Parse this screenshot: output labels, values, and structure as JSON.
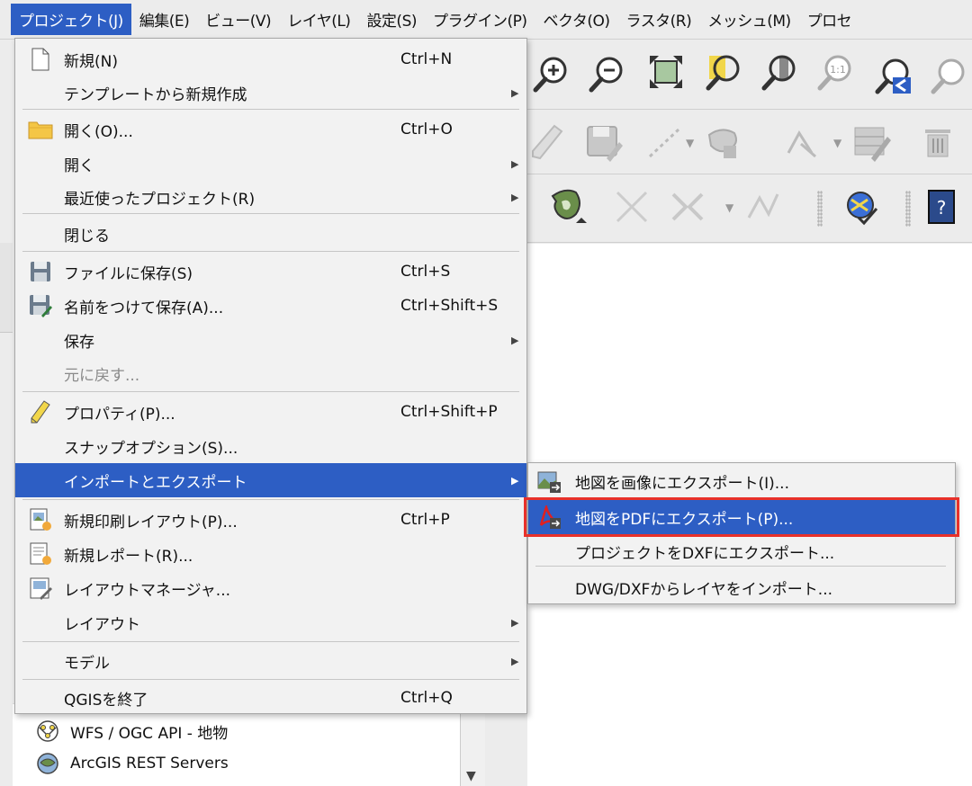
{
  "menubar": {
    "items": [
      "プロジェクト(J)",
      "編集(E)",
      "ビュー(V)",
      "レイヤ(L)",
      "設定(S)",
      "プラグイン(P)",
      "ベクタ(O)",
      "ラスタ(R)",
      "メッシュ(M)",
      "プロセ"
    ],
    "active_index": 0
  },
  "project_menu": {
    "items": [
      {
        "label": "新規(N)",
        "shortcut": "Ctrl+N",
        "icon": "new-file-icon"
      },
      {
        "label": "テンプレートから新規作成",
        "submenu": true
      },
      {
        "label": "開く(O)...",
        "shortcut": "Ctrl+O",
        "icon": "folder-icon"
      },
      {
        "label": "開く",
        "submenu": true
      },
      {
        "label": "最近使ったプロジェクト(R)",
        "submenu": true
      },
      {
        "label": "閉じる"
      },
      {
        "label": "ファイルに保存(S)",
        "shortcut": "Ctrl+S",
        "icon": "save-icon"
      },
      {
        "label": "名前をつけて保存(A)...",
        "shortcut": "Ctrl+Shift+S",
        "icon": "save-as-icon"
      },
      {
        "label": "保存",
        "submenu": true
      },
      {
        "label": "元に戻す...",
        "disabled": true
      },
      {
        "label": "プロパティ(P)...",
        "shortcut": "Ctrl+Shift+P",
        "icon": "pencil-icon"
      },
      {
        "label": "スナップオプション(S)..."
      },
      {
        "label": "インポートとエクスポート",
        "submenu": true,
        "active": true
      },
      {
        "label": "新規印刷レイアウト(P)...",
        "shortcut": "Ctrl+P",
        "icon": "new-print-layout-icon"
      },
      {
        "label": "新規レポート(R)...",
        "icon": "new-report-icon"
      },
      {
        "label": "レイアウトマネージャ...",
        "icon": "layout-manager-icon"
      },
      {
        "label": "レイアウト",
        "submenu": true
      },
      {
        "label": "モデル",
        "submenu": true
      },
      {
        "label": "QGISを終了",
        "shortcut": "Ctrl+Q"
      }
    ]
  },
  "import_export_submenu": {
    "items": [
      {
        "label": "地図を画像にエクスポート(I)...",
        "icon": "export-image-icon"
      },
      {
        "label": "地図をPDFにエクスポート(P)...",
        "icon": "export-pdf-icon",
        "active": true
      },
      {
        "label": "プロジェクトをDXFにエクスポート..."
      },
      {
        "label": "DWG/DXFからレイヤをインポート..."
      }
    ]
  },
  "browser": {
    "items": [
      {
        "label": "WFS / OGC API - 地物",
        "icon": "wfs-icon"
      },
      {
        "label": "ArcGIS REST Servers",
        "icon": "arcgis-icon"
      }
    ]
  },
  "colors": {
    "selection": "#2d5ec4",
    "highlight_border": "#e8312a"
  }
}
